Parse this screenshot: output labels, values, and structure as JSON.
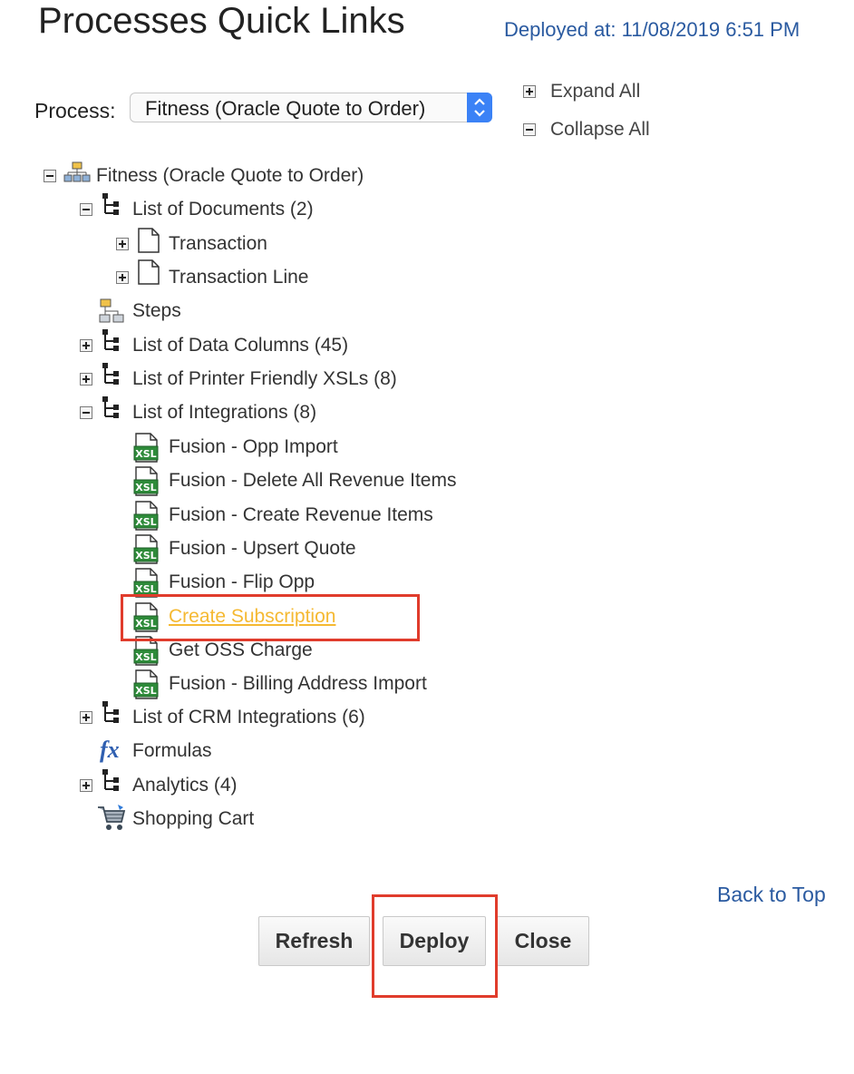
{
  "header": {
    "title": "Processes Quick Links",
    "deployed": "Deployed at: 11/08/2019 6:51 PM"
  },
  "process_selector": {
    "label": "Process:",
    "selected": "Fitness (Oracle Quote to Order)"
  },
  "tree_controls": {
    "expand_all": "Expand All",
    "collapse_all": "Collapse All"
  },
  "tree": {
    "root": "Fitness (Oracle Quote to Order)",
    "documents": "List of Documents (2)",
    "transaction": "Transaction",
    "transaction_line": "Transaction Line",
    "steps": "Steps",
    "data_columns": "List of Data Columns (45)",
    "printer_xsls": "List of Printer Friendly XSLs (8)",
    "integrations": "List of Integrations (8)",
    "integration_items": [
      "Fusion - Opp Import",
      "Fusion - Delete All Revenue Items",
      "Fusion - Create Revenue Items",
      "Fusion - Upsert Quote",
      "Fusion - Flip Opp",
      "Create Subscription",
      "Get OSS Charge",
      "Fusion - Billing Address Import"
    ],
    "crm_integrations": "List of CRM Integrations (6)",
    "formulas": "Formulas",
    "analytics": "Analytics (4)",
    "shopping_cart": "Shopping Cart"
  },
  "footer": {
    "back_to_top": "Back to Top",
    "refresh": "Refresh",
    "deploy": "Deploy",
    "close": "Close"
  },
  "icons": {
    "xsl_label": "XSL",
    "formula_label": "fx"
  },
  "colors": {
    "link_blue": "#2a5aa0",
    "highlight_link": "#f5b932",
    "annotation_red": "#e03c2c",
    "xsl_green": "#2e8b3a"
  }
}
